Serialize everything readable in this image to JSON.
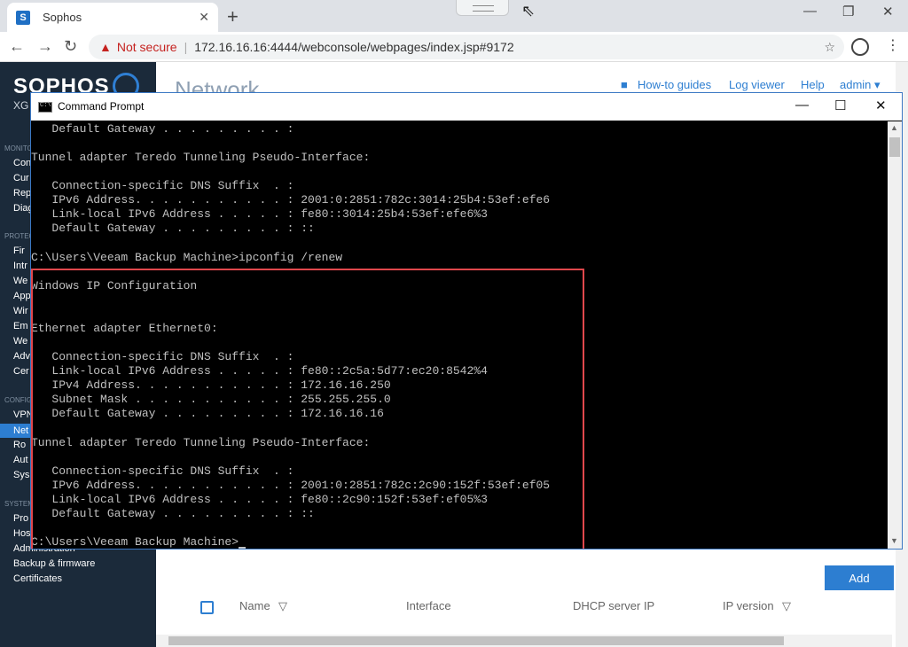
{
  "browser": {
    "tab_title": "Sophos",
    "favicon_letter": "S",
    "tab_close": "✕",
    "new_tab": "+",
    "security_label": "Not secure",
    "url": "172.16.16.16:4444/webconsole/webpages/index.jsp#9172",
    "minimize": "—",
    "restore": "❐",
    "close": "✕"
  },
  "sophos": {
    "logo": "SOPHOS",
    "product_short": "XG",
    "page_title": "Network",
    "top_links": [
      "How-to guides",
      "Log viewer",
      "Help",
      "admin ▾"
    ],
    "sidebar": {
      "sections": [
        "MONITOR",
        "PROTECT",
        "CONFIGURE",
        "SYSTEM"
      ],
      "monitor_items": [
        "Con",
        "Cur",
        "Rep",
        "Diag"
      ],
      "protect_items": [
        "Fir",
        "Intr",
        "We",
        "App",
        "Wir",
        "Em",
        "We",
        "Adv",
        "Cer"
      ],
      "configure_items": [
        "VPN",
        "Net",
        "Ro",
        "Aut",
        "Sys"
      ],
      "system_items": [
        "Pro",
        "Hos",
        "Administration",
        "Backup & firmware",
        "Certificates"
      ]
    },
    "add_button": "Add",
    "table_headers": [
      "Name",
      "Interface",
      "DHCP server IP",
      "IP version"
    ]
  },
  "cmd": {
    "title": "Command Prompt",
    "minimize": "—",
    "maximize": "☐",
    "close": "✕",
    "lines": [
      "   Default Gateway . . . . . . . . . :",
      "",
      "Tunnel adapter Teredo Tunneling Pseudo-Interface:",
      "",
      "   Connection-specific DNS Suffix  . :",
      "   IPv6 Address. . . . . . . . . . . : 2001:0:2851:782c:3014:25b4:53ef:efe6",
      "   Link-local IPv6 Address . . . . . : fe80::3014:25b4:53ef:efe6%3",
      "   Default Gateway . . . . . . . . . : ::",
      "",
      "C:\\Users\\Veeam Backup Machine>ipconfig /renew",
      "",
      "Windows IP Configuration",
      "",
      "",
      "Ethernet adapter Ethernet0:",
      "",
      "   Connection-specific DNS Suffix  . :",
      "   Link-local IPv6 Address . . . . . : fe80::2c5a:5d77:ec20:8542%4",
      "   IPv4 Address. . . . . . . . . . . : 172.16.16.250",
      "   Subnet Mask . . . . . . . . . . . : 255.255.255.0",
      "   Default Gateway . . . . . . . . . : 172.16.16.16",
      "",
      "Tunnel adapter Teredo Tunneling Pseudo-Interface:",
      "",
      "   Connection-specific DNS Suffix  . :",
      "   IPv6 Address. . . . . . . . . . . : 2001:0:2851:782c:2c90:152f:53ef:ef05",
      "   Link-local IPv6 Address . . . . . : fe80::2c90:152f:53ef:ef05%3",
      "   Default Gateway . . . . . . . . . : ::",
      "",
      "C:\\Users\\Veeam Backup Machine>"
    ]
  }
}
